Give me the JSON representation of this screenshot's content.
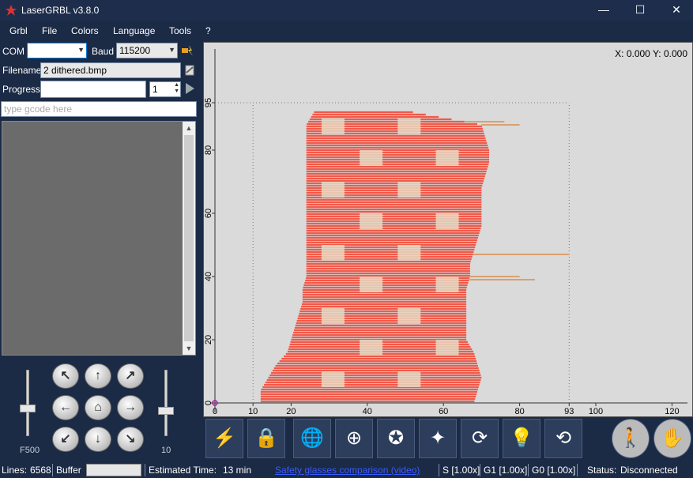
{
  "window": {
    "title": "LaserGRBL v3.8.0",
    "minimize": "—",
    "maximize": "☐",
    "close": "✕"
  },
  "menu": [
    "Grbl",
    "File",
    "Colors",
    "Language",
    "Tools",
    "?"
  ],
  "connection": {
    "com_label": "COM",
    "com_value": "",
    "baud_label": "Baud",
    "baud_value": "115200"
  },
  "file": {
    "filename_label": "Filename",
    "filename_value": "2 dithered.bmp",
    "progress_label": "Progress",
    "progress_value": "",
    "passes_value": "1"
  },
  "console": {
    "command_placeholder": "type gcode here"
  },
  "jog": {
    "feed_label": "F500",
    "step_label": "10",
    "feed_level": 0.42,
    "step_level": 0.38
  },
  "canvas": {
    "coords": "X: 0.000 Y: 0.000",
    "x_ticks": [
      "0",
      "10",
      "20",
      "40",
      "60",
      "80",
      "93",
      "100",
      "120"
    ],
    "y_ticks": [
      "0",
      "20",
      "40",
      "60",
      "80",
      "95"
    ]
  },
  "toolbar": [
    "flash-icon",
    "lock-icon",
    "globe-map-icon",
    "crosshair-icon",
    "star-frame-icon",
    "star-frame-alt-icon",
    "cycle-icon",
    "bulb-icon",
    "rotate-icon",
    "walk-icon",
    "stop-hand-icon"
  ],
  "status": {
    "lines_label": "Lines:",
    "lines_value": "6568",
    "buffer_label": "Buffer",
    "estimated_label": "Estimated Time:",
    "estimated_value": "13 min",
    "safety_link": "Safety glasses comparison (video)",
    "s_value": "S [1.00x]",
    "g1_value": "G1 [1.00x]",
    "g0_value": "G0 [1.00x]",
    "status_label": "Status:",
    "status_value": "Disconnected"
  },
  "colors": {
    "accent": "#1b2a45",
    "laser": "#f05a4a",
    "canvas": "#dadada"
  }
}
